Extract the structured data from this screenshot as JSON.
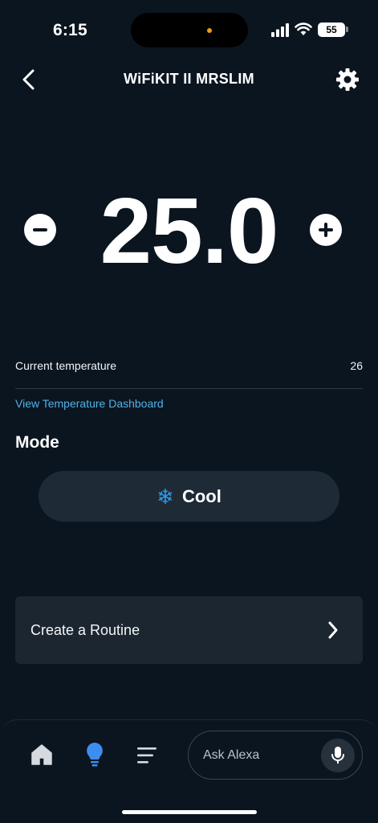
{
  "status_bar": {
    "time": "6:15",
    "battery": "55",
    "icons": [
      "cellular-signal-icon",
      "wifi-icon",
      "battery-icon"
    ]
  },
  "header": {
    "title": "WiFiKIT II MRSLIM",
    "back_icon": "chevron-left-icon",
    "settings_icon": "gear-icon"
  },
  "thermostat": {
    "setpoint": "25.0",
    "decrease_icon": "minus-icon",
    "increase_icon": "plus-icon"
  },
  "current_temperature": {
    "label": "Current temperature",
    "value": "26"
  },
  "dashboard_link": "View Temperature Dashboard",
  "mode": {
    "heading": "Mode",
    "value": "Cool",
    "icon": "snowflake-icon",
    "icon_color": "#2c9be8"
  },
  "routine": {
    "label": "Create a Routine",
    "icon": "chevron-right-icon"
  },
  "bottom_nav": {
    "items": [
      "home-icon",
      "lightbulb-icon",
      "menu-icon"
    ],
    "active_color": "#3d8ef0",
    "search_placeholder": "Ask Alexa",
    "mic_icon": "microphone-icon"
  },
  "colors": {
    "background": "#0b1520",
    "card": "#1c2631",
    "link": "#4fb2e8"
  }
}
